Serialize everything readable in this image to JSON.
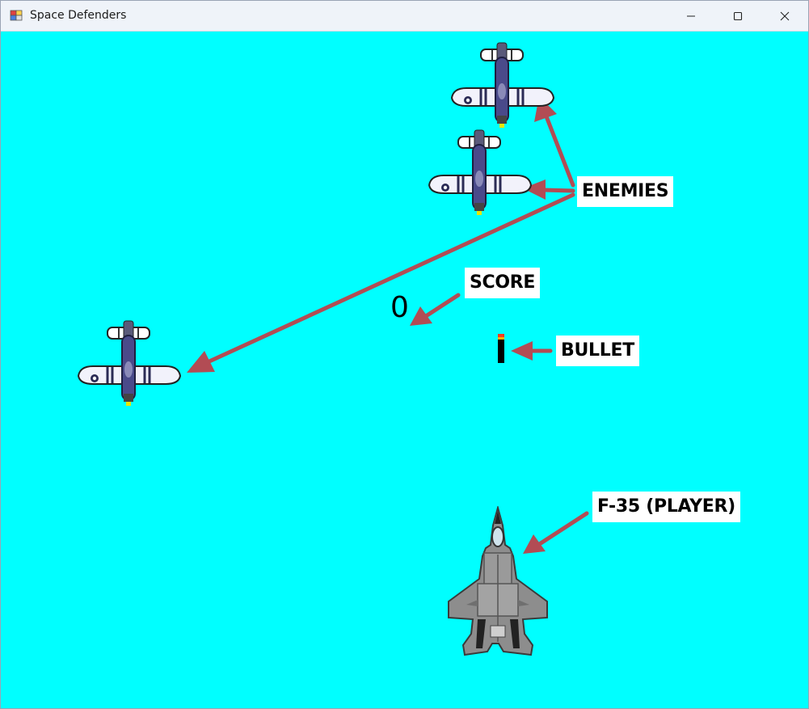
{
  "window": {
    "title": "Space Defenders"
  },
  "icons": {
    "app": "app-icon",
    "minimize": "minimize-icon",
    "maximize": "maximize-icon",
    "close": "close-icon"
  },
  "game": {
    "background_color": "#00ffff",
    "score": "0",
    "annotation_color": "#b24c54"
  },
  "labels": {
    "enemies": "ENEMIES",
    "score": "SCORE",
    "bullet": "BULLET",
    "player": "F-35 (PLAYER)"
  },
  "sprites": {
    "enemy": "p51-fighter-plane",
    "player": "f35-jet",
    "bullet": "bullet"
  }
}
